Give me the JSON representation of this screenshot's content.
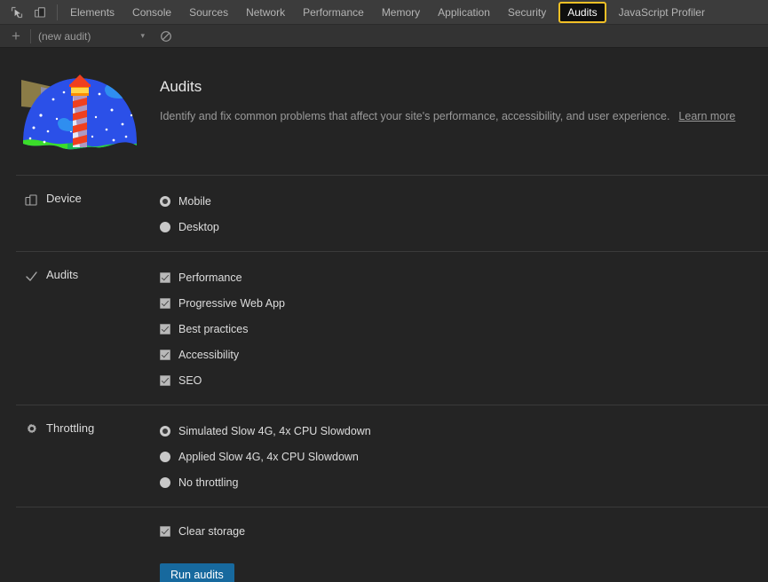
{
  "toolbar": {
    "icons": [
      {
        "name": "inspect-element-icon",
        "title": "Inspect element"
      },
      {
        "name": "device-toolbar-icon",
        "title": "Toggle device toolbar"
      }
    ],
    "tabs": [
      {
        "label": "Elements",
        "selected": false
      },
      {
        "label": "Console",
        "selected": false
      },
      {
        "label": "Sources",
        "selected": false
      },
      {
        "label": "Network",
        "selected": false
      },
      {
        "label": "Performance",
        "selected": false
      },
      {
        "label": "Memory",
        "selected": false
      },
      {
        "label": "Application",
        "selected": false
      },
      {
        "label": "Security",
        "selected": false
      },
      {
        "label": "Audits",
        "selected": true
      },
      {
        "label": "JavaScript Profiler",
        "selected": false
      }
    ],
    "selected_tab_outline_color": "#f2c026"
  },
  "subtoolbar": {
    "add_label": "+",
    "audit_select_value": "(new audit)",
    "chevron": "▾",
    "clear_icon_name": "clear-all-icon"
  },
  "hero": {
    "logo_name": "lighthouse-logo",
    "title": "Audits",
    "description": "Identify and fix common problems that affect your site's performance, accessibility, and user experience.",
    "learn_more_label": "Learn more"
  },
  "sections": [
    {
      "id": "device",
      "icon": "device-icon",
      "title": "Device",
      "control": "radio",
      "options": [
        {
          "label": "Mobile",
          "checked": true
        },
        {
          "label": "Desktop",
          "checked": false
        }
      ]
    },
    {
      "id": "audits",
      "icon": "checkmark-icon",
      "title": "Audits",
      "control": "checkbox",
      "options": [
        {
          "label": "Performance",
          "checked": true
        },
        {
          "label": "Progressive Web App",
          "checked": true
        },
        {
          "label": "Best practices",
          "checked": true
        },
        {
          "label": "Accessibility",
          "checked": true
        },
        {
          "label": "SEO",
          "checked": true
        }
      ]
    },
    {
      "id": "throttling",
      "icon": "gear-icon",
      "title": "Throttling",
      "control": "radio",
      "options": [
        {
          "label": "Simulated Slow 4G, 4x CPU Slowdown",
          "checked": true
        },
        {
          "label": "Applied Slow 4G, 4x CPU Slowdown",
          "checked": false
        },
        {
          "label": "No throttling",
          "checked": false
        }
      ]
    }
  ],
  "footer": {
    "clear_storage": {
      "label": "Clear storage",
      "checked": true
    },
    "run_button_label": "Run audits",
    "run_button_color": "#17699e"
  }
}
